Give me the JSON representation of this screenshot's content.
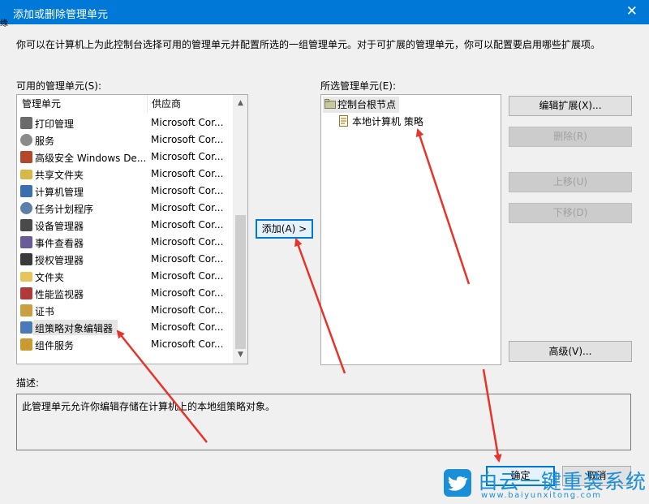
{
  "window": {
    "title": "添加或删除管理单元",
    "close_glyph": "✕",
    "left_edge_fragment": "缘"
  },
  "intro_text": "你可以在计算机上为此控制台选择可用的管理单元并配置所选的一组管理单元。对于可扩展的管理单元，你可以配置要启用哪些扩展项。",
  "available": {
    "label": "可用的管理单元(S):",
    "col_name": "管理单元",
    "col_vendor": "供应商",
    "items": [
      {
        "name": "打印管理",
        "vendor": "Microsoft Cor...",
        "icon": "printer-icon"
      },
      {
        "name": "服务",
        "vendor": "Microsoft Cor...",
        "icon": "services-gear-icon"
      },
      {
        "name": "高级安全 Windows De...",
        "vendor": "Microsoft Cor...",
        "icon": "firewall-icon"
      },
      {
        "name": "共享文件夹",
        "vendor": "Microsoft Cor...",
        "icon": "shared-folder-icon"
      },
      {
        "name": "计算机管理",
        "vendor": "Microsoft Cor...",
        "icon": "computer-management-icon"
      },
      {
        "name": "任务计划程序",
        "vendor": "Microsoft Cor...",
        "icon": "clock-icon"
      },
      {
        "name": "设备管理器",
        "vendor": "Microsoft Cor...",
        "icon": "device-manager-icon"
      },
      {
        "name": "事件查看器",
        "vendor": "Microsoft Cor...",
        "icon": "event-viewer-icon"
      },
      {
        "name": "授权管理器",
        "vendor": "Microsoft Cor...",
        "icon": "authorization-icon"
      },
      {
        "name": "文件夹",
        "vendor": "Microsoft Cor...",
        "icon": "folder-icon"
      },
      {
        "name": "性能监视器",
        "vendor": "Microsoft Cor...",
        "icon": "performance-monitor-icon"
      },
      {
        "name": "证书",
        "vendor": "Microsoft Cor...",
        "icon": "certificate-icon"
      },
      {
        "name": "组策略对象编辑器",
        "vendor": "Microsoft Cor...",
        "icon": "group-policy-icon",
        "selected": true
      },
      {
        "name": "组件服务",
        "vendor": "Microsoft Cor...",
        "icon": "component-services-icon"
      }
    ]
  },
  "add_button": "添加(A) >",
  "selected": {
    "label": "所选管理单元(E):",
    "root": "控制台根节点",
    "child": "本地计算机 策略"
  },
  "side_buttons": {
    "edit_ext": "编辑扩展(X)...",
    "remove": "删除(R)",
    "move_up": "上移(U)",
    "move_down": "下移(D)",
    "advanced": "高级(V)..."
  },
  "description": {
    "label": "描述:",
    "text": "此管理单元允许你编辑存储在计算机上的本地组策略对象。"
  },
  "footer": {
    "ok": "确定",
    "cancel": "取消"
  },
  "watermark": {
    "text": "白云一键重装系统",
    "url": "www.baiyunxitong.com"
  },
  "colors": {
    "titlebar": "#0078d7",
    "annotation_arrow": "#e8322a",
    "watermark": "#1a8fd8"
  }
}
